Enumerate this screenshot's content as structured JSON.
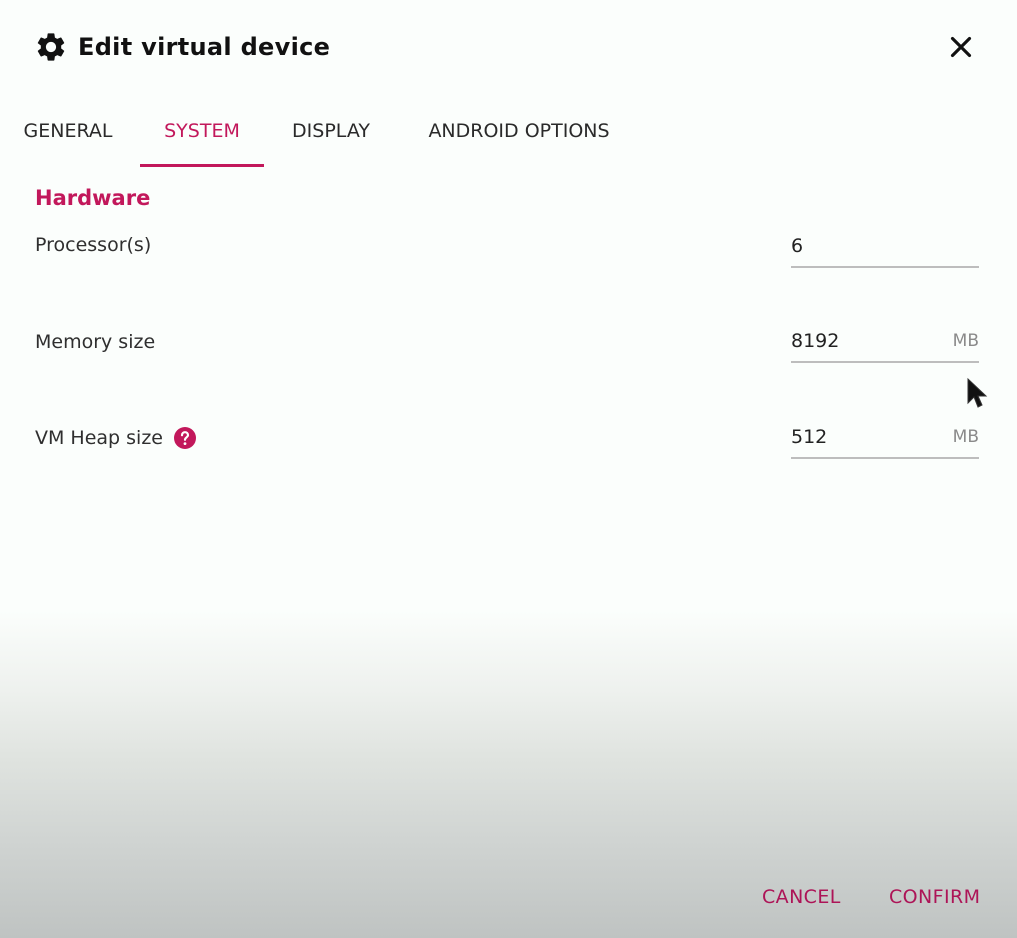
{
  "dialog": {
    "title": "Edit virtual device",
    "title_icon": "gear-icon",
    "close_icon": "close-icon"
  },
  "tabs": [
    {
      "label": "GENERAL",
      "active": false
    },
    {
      "label": "SYSTEM",
      "active": true
    },
    {
      "label": "DISPLAY",
      "active": false
    },
    {
      "label": "ANDROID OPTIONS",
      "active": false
    }
  ],
  "hardware": {
    "section_title": "Hardware",
    "fields": [
      {
        "label": "Processor(s)",
        "value": "6",
        "unit": ""
      },
      {
        "label": "Memory size",
        "value": "8192",
        "unit": "MB"
      },
      {
        "label": "VM Heap size",
        "value": "512",
        "unit": "MB",
        "help_icon": "help-icon"
      }
    ]
  },
  "actions": {
    "cancel_label": "CANCEL",
    "confirm_label": "CONFIRM"
  },
  "colors": {
    "accent": "#c2185b",
    "button_text": "#ad1457",
    "underline": "#bdbdbd"
  }
}
